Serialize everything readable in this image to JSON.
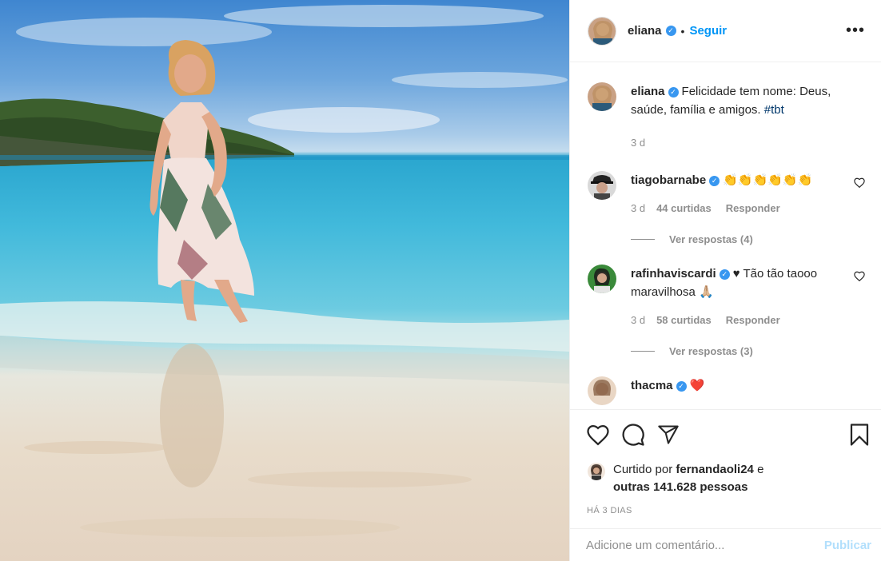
{
  "post": {
    "author": "eliana",
    "follow_label": "Seguir",
    "separator": "•",
    "more_label": "•••"
  },
  "caption": {
    "author": "eliana",
    "text": "Felicidade tem nome: Deus, saúde, família e amigos. ",
    "hashtag": "#tbt",
    "time": "3 d"
  },
  "comments": [
    {
      "user": "tiagobarnabe",
      "text": "👏👏👏👏👏👏",
      "time": "3 d",
      "likes": "44 curtidas",
      "reply": "Responder",
      "view_replies": "Ver respostas (4)"
    },
    {
      "user": "rafinhaviscardi",
      "text": "♥ Tão tão taooo maravilhosa 🙏🏼",
      "time": "3 d",
      "likes": "58 curtidas",
      "reply": "Responder",
      "view_replies": "Ver respostas (3)"
    },
    {
      "user": "thacma",
      "text": "❤️"
    }
  ],
  "likes": {
    "prefix": "Curtido por ",
    "user": "fernandaoli24",
    "middle": " e",
    "others": "outras 141.628 pessoas"
  },
  "timestamp": "HÁ 3 DIAS",
  "add_comment": {
    "placeholder": "Adicione um comentário...",
    "publish_label": "Publicar"
  },
  "colors": {
    "accent": "#0095f6",
    "verified": "#3897f0",
    "publish_disabled": "#b2dffc",
    "muted": "#8e8e8e"
  },
  "icons": [
    "heart-icon",
    "comment-icon",
    "share-icon",
    "bookmark-icon",
    "verified-icon",
    "more-icon"
  ]
}
